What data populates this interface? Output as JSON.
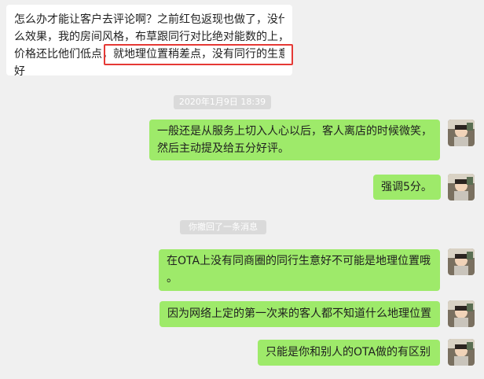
{
  "messages": {
    "incoming": {
      "lines": [
        "怎么办才能让客户去评论啊？之前红包返现也做了，没什",
        "么效果，我的房间风格，布草跟同行对比绝对能数的上，",
        "价格还比他们低点，就地理位置稍差点，没有同行的生意",
        "好"
      ]
    },
    "timestamp": "2020年1月9日 18:39",
    "outgoing1": {
      "lines": [
        "一般还是从服务上切入人心以后，客人离店的时候微笑，",
        "然后主动提及给五分好评。"
      ]
    },
    "outgoing2": {
      "text": "强调5分。"
    },
    "recall_notice": "你撤回了一条消息",
    "outgoing3": {
      "lines": [
        "在OTA上没有同商圈的同行生意好不可能是地理位置哦",
        "。"
      ]
    },
    "outgoing4": {
      "text": "因为网络上定的第一次来的客人都不知道什么地理位置"
    },
    "outgoing5": {
      "text": "只能是你和别人的OTA做的有区别"
    }
  },
  "colors": {
    "background": "#f0f0f0",
    "incoming_bubble": "#ffffff",
    "outgoing_bubble": "#9eea6a",
    "timestamp_bg": "#dadada",
    "highlight": "#e53935"
  },
  "avatar_icon": "avatar-icon"
}
